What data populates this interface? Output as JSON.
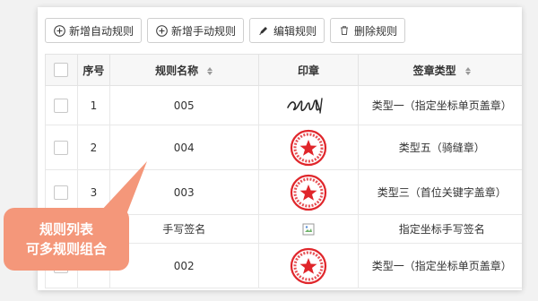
{
  "toolbar": {
    "add_auto": "新增自动规则",
    "add_manual": "新增手动规则",
    "edit": "编辑规则",
    "delete": "删除规则"
  },
  "table": {
    "headers": {
      "index": "序号",
      "rule_name": "规则名称",
      "seal": "印章",
      "seal_type": "签章类型"
    },
    "rows": [
      {
        "index": "1",
        "name": "005",
        "seal": "signature",
        "type": "类型一（指定坐标单页盖章）"
      },
      {
        "index": "2",
        "name": "004",
        "seal": "red-seal",
        "type": "类型五（骑缝章）"
      },
      {
        "index": "3",
        "name": "003",
        "seal": "red-seal",
        "type": "类型三（首位关键字盖章）"
      },
      {
        "index": "",
        "name": "手写签名",
        "seal": "broken-image",
        "type": "指定坐标手写签名"
      },
      {
        "index": "",
        "name": "002",
        "seal": "red-seal",
        "type": "类型一（指定坐标单页盖章）"
      }
    ]
  },
  "callout": {
    "line1": "规则列表",
    "line2": "可多规则组合",
    "color": "#f4977a"
  },
  "colors": {
    "seal_red": "#e0262b",
    "header_bg": "#f7f7f7"
  }
}
